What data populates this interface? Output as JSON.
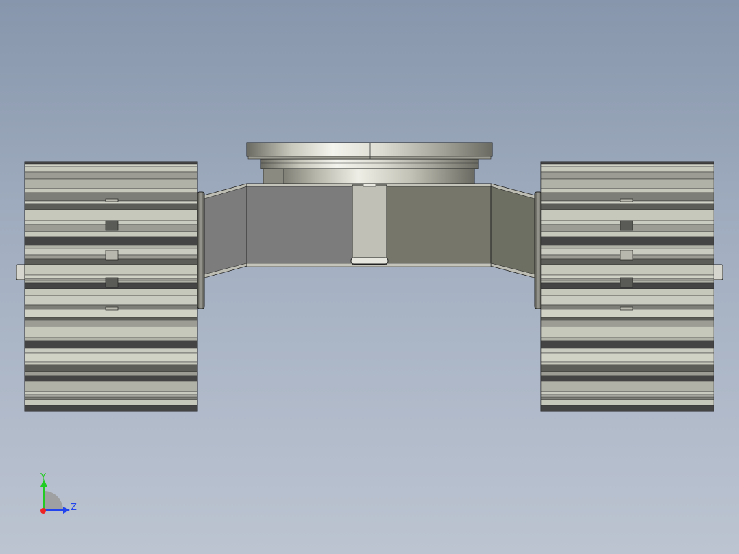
{
  "viewport": {
    "background_top": "#8796ac",
    "background_bottom": "#bcc4d1"
  },
  "model": {
    "track_band_colors": [
      "#444444",
      "#d0d2c6",
      "#9c9c94",
      "#c6c8bc",
      "#7e7e78",
      "#b0b2a8",
      "#5c5c58",
      "#cacbc0"
    ],
    "body_left_color": "#7c7c7c",
    "body_right_color": "#76776a",
    "turntable_highlight": "#f4f4ee",
    "turntable_shadow": "#6a6a62"
  },
  "triad": {
    "y_label": "Y",
    "z_label": "Z",
    "y_color": "#22cc22",
    "z_color": "#2244ee",
    "x_color": "#ee2222"
  }
}
